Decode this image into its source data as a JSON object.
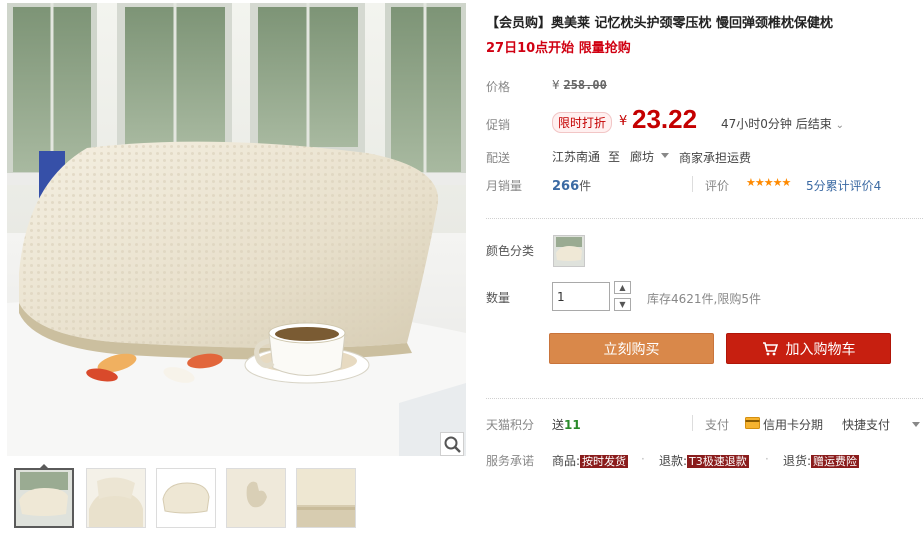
{
  "product": {
    "title": "【会员购】奥美莱 记忆枕头护颈零压枕 慢回弹颈椎枕保健枕",
    "subtitle": "27日10点开始 限量抢购"
  },
  "price": {
    "label": "价格",
    "currency": "¥",
    "original": "258.00"
  },
  "promo": {
    "label": "促销",
    "tag": "限时打折",
    "currency": "¥",
    "price": "23.22",
    "countdown": "47小时0分钟 后结束"
  },
  "shipping": {
    "label": "配送",
    "from": "江苏南通",
    "to_word": "至",
    "destination": "廊坊",
    "fee": "商家承担运费"
  },
  "sales": {
    "label": "月销量",
    "count": "266",
    "unit": "件"
  },
  "rating": {
    "label": "评价",
    "stars": "★★★★★",
    "score_text": "5分",
    "count_text": "累计评价4"
  },
  "options": {
    "color_label": "颜色分类"
  },
  "quantity": {
    "label": "数量",
    "value": "1",
    "stock": "库存4621件,限购5件"
  },
  "buttons": {
    "buy_now": "立刻购买",
    "add_cart": "加入购物车"
  },
  "points": {
    "label": "天猫积分",
    "prefix": "送",
    "value": "11"
  },
  "payment": {
    "label": "支付",
    "credit": "信用卡分期",
    "quick": "快捷支付"
  },
  "service": {
    "label": "服务承诺",
    "goods_prefix": "商品:",
    "goods_badge": "按时发货",
    "refund_prefix": "退款:",
    "refund_badge": "T3极速退款",
    "return_prefix": "退货:",
    "return_badge": "赠运费险"
  },
  "colors": {
    "price_red": "#c40000",
    "buy_button": "#d9884a",
    "cart_button": "#c71f10",
    "link_blue": "#3b6aa3",
    "star_orange": "#ff8a00"
  },
  "icons": [
    "zoom-icon",
    "chevron-down-icon",
    "cart-icon",
    "credit-card-icon",
    "arrow-up-icon",
    "arrow-down-icon"
  ]
}
